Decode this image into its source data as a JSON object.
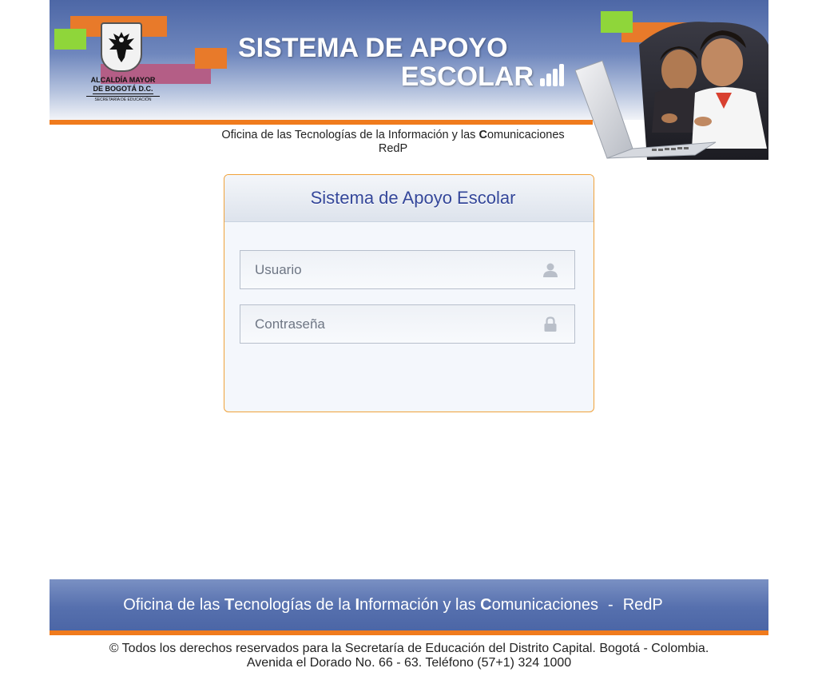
{
  "header": {
    "title_line1": "SISTEMA DE APOYO",
    "title_line2": "ESCOLAR",
    "logo": {
      "line1": "ALCALDÍA MAYOR",
      "line2": "DE BOGOTÁ D.C.",
      "line3": "SECRETARÍA DE EDUCACIÓN"
    },
    "office": {
      "p1": "Oficina de las Tecnologías de la Información y las ",
      "p2": "C",
      "p3": "omunicaciones",
      "line2": "RedP"
    },
    "colors": {
      "orange": "#f07b1d",
      "green": "#8fd63a",
      "blue": "#4d67a6"
    }
  },
  "login": {
    "title": "Sistema de Apoyo Escolar",
    "username_placeholder": "Usuario",
    "username_value": "",
    "password_placeholder": "Contraseña",
    "password_value": "",
    "user_icon": "user-icon",
    "lock_icon": "lock-icon"
  },
  "footer": {
    "p1": "Oficina de las ",
    "c1": "T",
    "p2": "ecnologías de la ",
    "c2": "I",
    "p3": "nformación y las ",
    "c3": "C",
    "p4": "omunicaciones",
    "separator": "-",
    "redp": "RedP",
    "copyright_line1": "© Todos los derechos reservados para la Secretaría de Educación del Distrito Capital. Bogotá - Colombia.",
    "copyright_line2": "Avenida el Dorado No. 66 - 63. Teléfono (57+1) 324 1000"
  }
}
